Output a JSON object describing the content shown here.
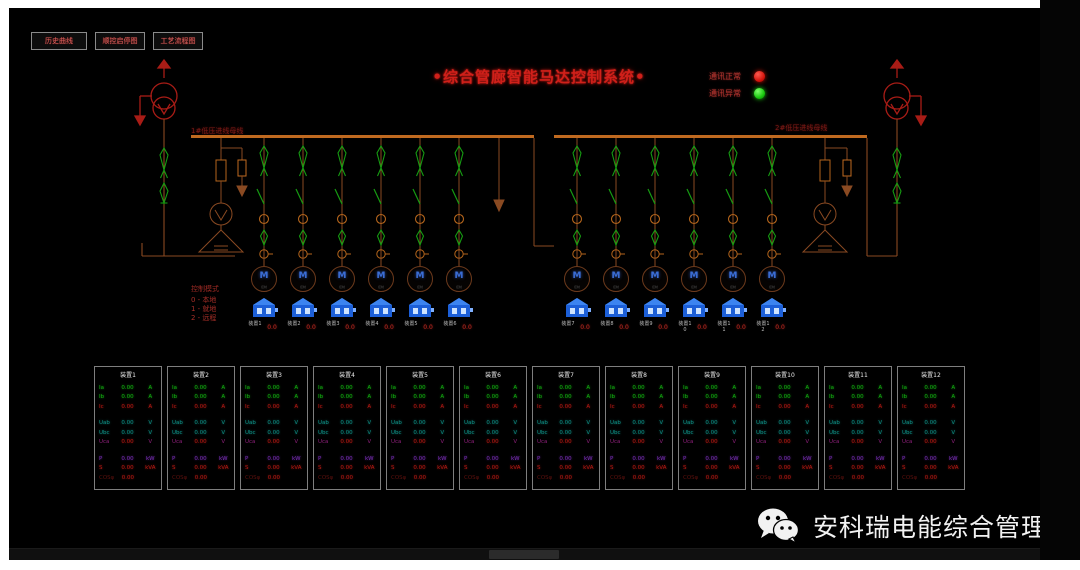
{
  "window": {
    "background": "#000000",
    "frame_color": "#ffffff"
  },
  "toolbar": {
    "buttons": [
      {
        "label": "历史曲线",
        "name": "history-curve-button"
      },
      {
        "label": "顺控启停图",
        "name": "sequence-control-button"
      },
      {
        "label": "工艺流程图",
        "name": "process-flow-button"
      }
    ]
  },
  "header": {
    "title": "•综合管廊智能马达控制系统•",
    "title_color": "#d0201a"
  },
  "comm_status": [
    {
      "label": "通讯正常",
      "color": "#d21109",
      "state": "red"
    },
    {
      "label": "通讯异常",
      "color": "#16c60c",
      "state": "green"
    }
  ],
  "diagram": {
    "bus_label_left": "1#低压进线母线",
    "bus_label_right": "2#低压进线母线",
    "line_color": "#8a4a22",
    "bus_color": "#c06a20",
    "switch_green": "#1aa015",
    "cb_orange": "#b4651c",
    "incoming_red": "#a81c16",
    "control_mode_legend": {
      "title": "控制模式",
      "items": [
        "0 - 本地",
        "1 - 就地",
        "2 - 远程"
      ]
    },
    "motors": [
      {
        "id": "M",
        "label": "装置1",
        "value": "0.0",
        "sub": "控制"
      },
      {
        "id": "M",
        "label": "装置2",
        "value": "0.0",
        "sub": "控制"
      },
      {
        "id": "M",
        "label": "装置3",
        "value": "0.0",
        "sub": "控制"
      },
      {
        "id": "M",
        "label": "装置4",
        "value": "0.0",
        "sub": "控制"
      },
      {
        "id": "M",
        "label": "装置5",
        "value": "0.0",
        "sub": "控制"
      },
      {
        "id": "M",
        "label": "装置6",
        "value": "0.0",
        "sub": "控制"
      },
      {
        "id": "M",
        "label": "装置7",
        "value": "0.0",
        "sub": "控制"
      },
      {
        "id": "M",
        "label": "装置8",
        "value": "0.0",
        "sub": "控制"
      },
      {
        "id": "M",
        "label": "装置9",
        "value": "0.0",
        "sub": "控制"
      },
      {
        "id": "M",
        "label": "装置10",
        "value": "0.0",
        "sub": "控制"
      },
      {
        "id": "M",
        "label": "装置11",
        "value": "0.0",
        "sub": "控制"
      },
      {
        "id": "M",
        "label": "装置12",
        "value": "0.0",
        "sub": "控制"
      }
    ]
  },
  "measurement": {
    "row_keys": [
      "Ia",
      "Ib",
      "Ic",
      "Uab",
      "Ubc",
      "Uca",
      "P",
      "S",
      "COSφ"
    ],
    "row_units": [
      "A",
      "A",
      "A",
      "V",
      "V",
      "V",
      "kW",
      "kVA",
      ""
    ],
    "panels": [
      {
        "title": "装置1",
        "values": [
          "0.00",
          "0.00",
          "0.00",
          "0.00",
          "0.00",
          "0.00",
          "0.00",
          "0.00",
          "0.00"
        ]
      },
      {
        "title": "装置2",
        "values": [
          "0.00",
          "0.00",
          "0.00",
          "0.00",
          "0.00",
          "0.00",
          "0.00",
          "0.00",
          "0.00"
        ]
      },
      {
        "title": "装置3",
        "values": [
          "0.00",
          "0.00",
          "0.00",
          "0.00",
          "0.00",
          "0.00",
          "0.00",
          "0.00",
          "0.00"
        ]
      },
      {
        "title": "装置4",
        "values": [
          "0.00",
          "0.00",
          "0.00",
          "0.00",
          "0.00",
          "0.00",
          "0.00",
          "0.00",
          "0.00"
        ]
      },
      {
        "title": "装置5",
        "values": [
          "0.00",
          "0.00",
          "0.00",
          "0.00",
          "0.00",
          "0.00",
          "0.00",
          "0.00",
          "0.00"
        ]
      },
      {
        "title": "装置6",
        "values": [
          "0.00",
          "0.00",
          "0.00",
          "0.00",
          "0.00",
          "0.00",
          "0.00",
          "0.00",
          "0.00"
        ]
      },
      {
        "title": "装置7",
        "values": [
          "0.00",
          "0.00",
          "0.00",
          "0.00",
          "0.00",
          "0.00",
          "0.00",
          "0.00",
          "0.00"
        ]
      },
      {
        "title": "装置8",
        "values": [
          "0.00",
          "0.00",
          "0.00",
          "0.00",
          "0.00",
          "0.00",
          "0.00",
          "0.00",
          "0.00"
        ]
      },
      {
        "title": "装置9",
        "values": [
          "0.00",
          "0.00",
          "0.00",
          "0.00",
          "0.00",
          "0.00",
          "0.00",
          "0.00",
          "0.00"
        ]
      },
      {
        "title": "装置10",
        "values": [
          "0.00",
          "0.00",
          "0.00",
          "0.00",
          "0.00",
          "0.00",
          "0.00",
          "0.00",
          "0.00"
        ]
      },
      {
        "title": "装置11",
        "values": [
          "0.00",
          "0.00",
          "0.00",
          "0.00",
          "0.00",
          "0.00",
          "0.00",
          "0.00",
          "0.00"
        ]
      },
      {
        "title": "装置12",
        "values": [
          "0.00",
          "0.00",
          "0.00",
          "0.00",
          "0.00",
          "0.00",
          "0.00",
          "0.00",
          "0.00"
        ]
      }
    ]
  },
  "watermark": {
    "text": "安科瑞电能综合管理",
    "icon": "wechat-icon"
  }
}
